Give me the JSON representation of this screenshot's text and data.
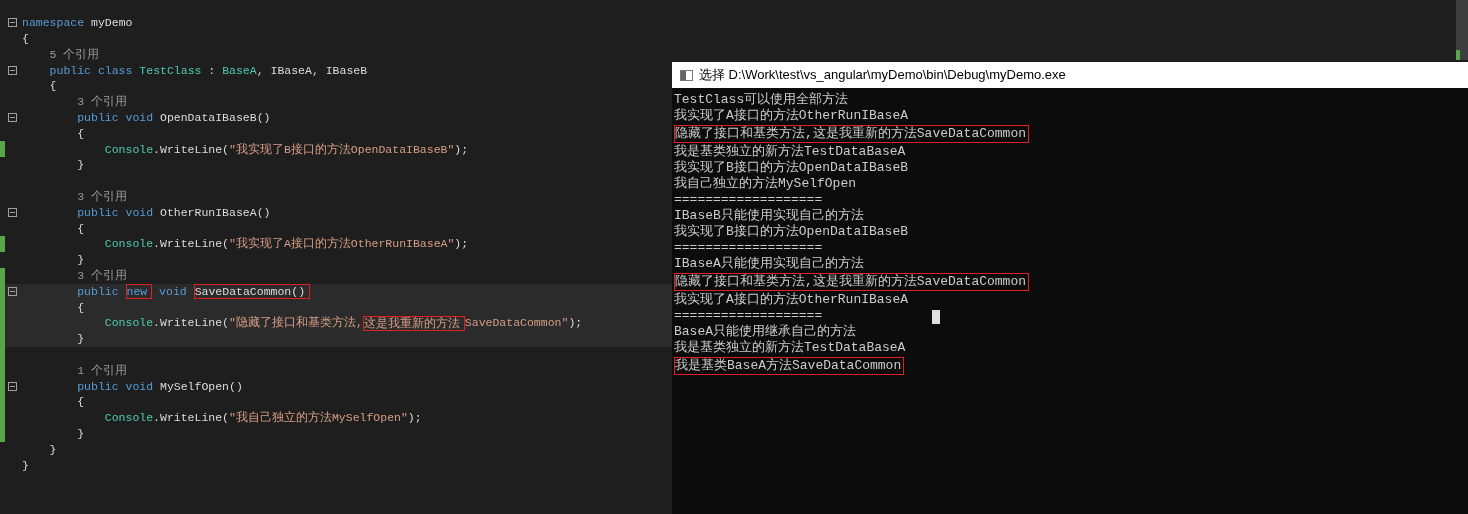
{
  "editor": {
    "lines": [
      {
        "kind": "code",
        "fold": true,
        "tokens": [
          {
            "kind": "keyword",
            "text": "namespace"
          },
          {
            "kind": "plain",
            "text": " myDemo"
          }
        ]
      },
      {
        "kind": "code",
        "tokens": [
          {
            "kind": "plain",
            "text": "{"
          }
        ],
        "children": [
          {
            "kind": "code",
            "tokens": [
              {
                "kind": "codelens",
                "text": "5 个引用"
              }
            ]
          },
          {
            "kind": "code",
            "fold": true,
            "tokens": [
              {
                "kind": "keyword",
                "text": "public class"
              },
              {
                "kind": "type",
                "text": " TestClass"
              },
              {
                "kind": "plain",
                "text": " : "
              },
              {
                "kind": "type",
                "text": "BaseA"
              },
              {
                "kind": "plain",
                "text": ", IBaseA, IBaseB"
              }
            ]
          },
          {
            "kind": "code",
            "tokens": [
              {
                "kind": "plain",
                "text": "{"
              }
            ],
            "children": [
              {
                "kind": "code",
                "tokens": [
                  {
                    "kind": "codelens",
                    "text": "3 个引用"
                  }
                ]
              },
              {
                "kind": "code",
                "fold": true,
                "tokens": [
                  {
                    "kind": "keyword",
                    "text": "public void"
                  },
                  {
                    "kind": "plain",
                    "text": " OpenDataIBaseB()"
                  }
                ]
              },
              {
                "kind": "code",
                "tokens": [
                  {
                    "kind": "plain",
                    "text": "{"
                  }
                ],
                "children": [
                  {
                    "kind": "code",
                    "changed": true,
                    "tokens": [
                      {
                        "kind": "type",
                        "text": "Console"
                      },
                      {
                        "kind": "plain",
                        "text": ".WriteLine("
                      },
                      {
                        "kind": "string",
                        "text": "\"我实现了B接口的方法OpenDataIBaseB\""
                      },
                      {
                        "kind": "plain",
                        "text": ");"
                      }
                    ]
                  }
                ]
              },
              {
                "kind": "code",
                "tokens": [
                  {
                    "kind": "plain",
                    "text": "}"
                  }
                ]
              },
              {
                "kind": "blank"
              },
              {
                "kind": "code",
                "tokens": [
                  {
                    "kind": "codelens",
                    "text": "3 个引用"
                  }
                ]
              },
              {
                "kind": "code",
                "fold": true,
                "tokens": [
                  {
                    "kind": "keyword",
                    "text": "public void"
                  },
                  {
                    "kind": "plain",
                    "text": " OtherRunIBaseA()"
                  }
                ]
              },
              {
                "kind": "code",
                "tokens": [
                  {
                    "kind": "plain",
                    "text": "{"
                  }
                ],
                "children": [
                  {
                    "kind": "code",
                    "changed": true,
                    "tokens": [
                      {
                        "kind": "type",
                        "text": "Console"
                      },
                      {
                        "kind": "plain",
                        "text": ".WriteLine("
                      },
                      {
                        "kind": "string",
                        "text": "\"我实现了A接口的方法OtherRunIBaseA\""
                      },
                      {
                        "kind": "plain",
                        "text": ");"
                      }
                    ]
                  }
                ]
              },
              {
                "kind": "code",
                "tokens": [
                  {
                    "kind": "plain",
                    "text": "}"
                  }
                ]
              },
              {
                "kind": "code",
                "changed": true,
                "tokens": [
                  {
                    "kind": "codelens",
                    "text": "3 个引用"
                  }
                ]
              },
              {
                "kind": "code",
                "fold": true,
                "changed": true,
                "highlighted": true,
                "tokens": [
                  {
                    "kind": "keyword",
                    "text": "public "
                  },
                  {
                    "kind": "keyword",
                    "text": "new",
                    "boxed": true
                  },
                  {
                    "kind": "keyword",
                    "text": " void "
                  },
                  {
                    "kind": "plain",
                    "text": "SaveDataCommon()",
                    "boxed": true
                  }
                ]
              },
              {
                "kind": "code",
                "changed": true,
                "highlighted": true,
                "tokens": [
                  {
                    "kind": "plain",
                    "text": "{"
                  }
                ],
                "children": [
                  {
                    "kind": "code",
                    "changed": true,
                    "highlighted": true,
                    "tokens": [
                      {
                        "kind": "type",
                        "text": "Console"
                      },
                      {
                        "kind": "plain",
                        "text": ".WriteLine("
                      },
                      {
                        "kind": "string",
                        "text": "\"隐藏了接口和基类方法,"
                      },
                      {
                        "kind": "string",
                        "text": "这是我重新的方法",
                        "boxed": true
                      },
                      {
                        "kind": "string",
                        "text": "SaveDataCommon\""
                      },
                      {
                        "kind": "plain",
                        "text": ");"
                      }
                    ]
                  }
                ]
              },
              {
                "kind": "code",
                "changed": true,
                "highlighted": true,
                "tokens": [
                  {
                    "kind": "plain",
                    "text": "}"
                  }
                ]
              },
              {
                "kind": "blank",
                "changed": true
              },
              {
                "kind": "code",
                "changed": true,
                "tokens": [
                  {
                    "kind": "codelens",
                    "text": "1 个引用"
                  }
                ]
              },
              {
                "kind": "code",
                "fold": true,
                "changed": true,
                "tokens": [
                  {
                    "kind": "keyword",
                    "text": "public void"
                  },
                  {
                    "kind": "plain",
                    "text": " MySelfOpen()"
                  }
                ]
              },
              {
                "kind": "code",
                "changed": true,
                "tokens": [
                  {
                    "kind": "plain",
                    "text": "{"
                  }
                ],
                "children": [
                  {
                    "kind": "code",
                    "changed": true,
                    "tokens": [
                      {
                        "kind": "type",
                        "text": "Console"
                      },
                      {
                        "kind": "plain",
                        "text": ".WriteLine("
                      },
                      {
                        "kind": "string",
                        "text": "\"我自己独立的方法MySelfOpen\""
                      },
                      {
                        "kind": "plain",
                        "text": ");"
                      }
                    ]
                  }
                ]
              },
              {
                "kind": "code",
                "changed": true,
                "tokens": [
                  {
                    "kind": "plain",
                    "text": "}"
                  }
                ]
              }
            ]
          },
          {
            "kind": "code",
            "tokens": [
              {
                "kind": "plain",
                "text": "}"
              }
            ]
          }
        ]
      },
      {
        "kind": "code",
        "tokens": [
          {
            "kind": "plain",
            "text": "}"
          }
        ]
      }
    ]
  },
  "console": {
    "title": "选择 D:\\Work\\test\\vs_angular\\myDemo\\bin\\Debug\\myDemo.exe",
    "lines": [
      {
        "text": "TestClass可以使用全部方法",
        "boxed": false
      },
      {
        "text": "我实现了A接口的方法OtherRunIBaseA",
        "boxed": false
      },
      {
        "text": "隐藏了接口和基类方法,这是我重新的方法SaveDataCommon",
        "boxed": true
      },
      {
        "text": "我是基类独立的新方法TestDataBaseA",
        "boxed": false
      },
      {
        "text": "我实现了B接口的方法OpenDataIBaseB",
        "boxed": false
      },
      {
        "text": "我自己独立的方法MySelfOpen",
        "boxed": false
      },
      {
        "text": "===================",
        "boxed": false
      },
      {
        "text": "IBaseB只能使用实现自己的方法",
        "boxed": false
      },
      {
        "text": "我实现了B接口的方法OpenDataIBaseB",
        "boxed": false
      },
      {
        "text": "===================",
        "boxed": false
      },
      {
        "text": "IBaseA只能使用实现自己的方法",
        "boxed": false
      },
      {
        "text": "隐藏了接口和基类方法,这是我重新的方法SaveDataCommon",
        "boxed": true
      },
      {
        "text": "我实现了A接口的方法OtherRunIBaseA",
        "boxed": false
      },
      {
        "text": "===================",
        "boxed": false,
        "cursor": true
      },
      {
        "text": "BaseA只能使用继承自己的方法",
        "boxed": false
      },
      {
        "text": "我是基类独立的新方法TestDataBaseA",
        "boxed": false
      },
      {
        "text": "我是基类BaseA方法SaveDataCommon",
        "boxed": true
      }
    ]
  }
}
